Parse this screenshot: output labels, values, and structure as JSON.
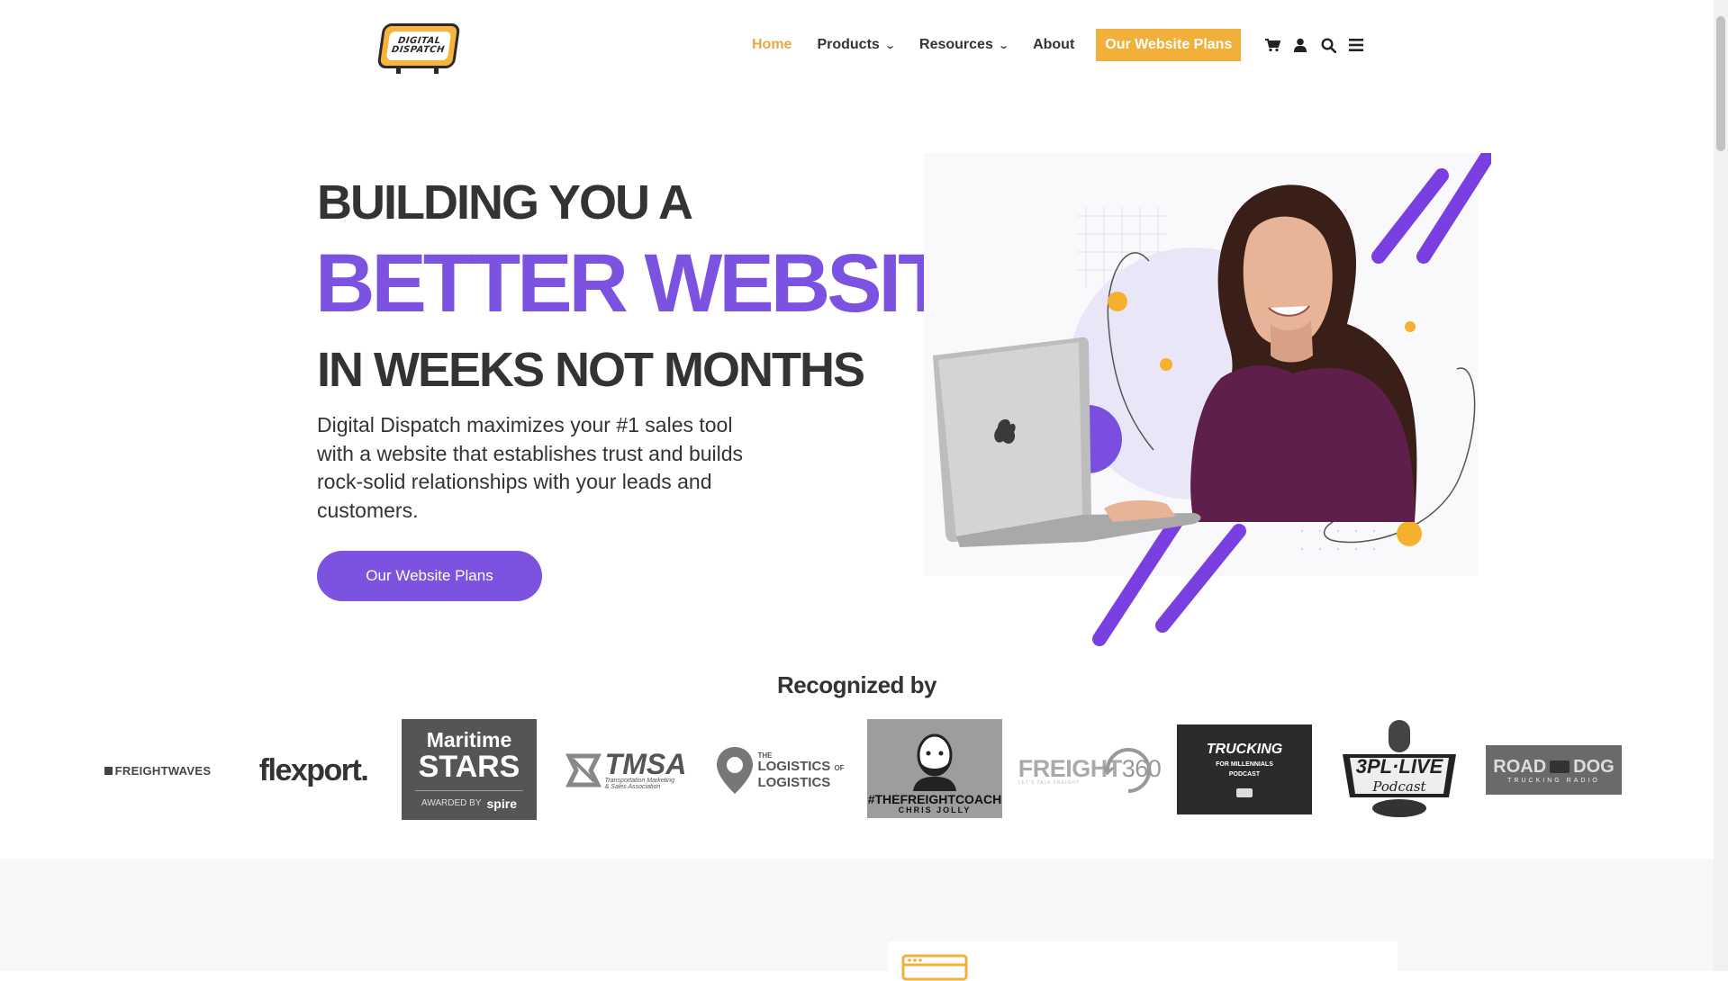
{
  "logo": {
    "line1": "DIGITAL",
    "line2": "DISPATCH"
  },
  "nav": {
    "items": [
      {
        "label": "Home",
        "active": true
      },
      {
        "label": "Products",
        "dropdown": true
      },
      {
        "label": "Resources",
        "dropdown": true
      },
      {
        "label": "About"
      }
    ],
    "cta_label": "Our Website Plans",
    "icons": [
      "cart-icon",
      "user-icon",
      "search-icon",
      "menu-icon"
    ]
  },
  "hero": {
    "line1": "BUILDING YOU A",
    "line2": "BETTER WEBSITE",
    "line3": "IN WEEKS NOT MONTHS",
    "description": "Digital Dispatch maximizes your #1 sales tool with a website that establishes trust and builds rock-solid relationships with your leads and customers.",
    "button_label": "Our Website Plans"
  },
  "recognized": {
    "title": "Recognized by",
    "logos": [
      {
        "text": "FREIGHTWAVES"
      },
      {
        "text": "flexport."
      },
      {
        "line1": "Maritime",
        "line2": "STARS",
        "sub": "AWARDED BY",
        "brand": "spire"
      },
      {
        "text": "TMSA",
        "sub1": "Transportation Marketing",
        "sub2": "& Sales Association"
      },
      {
        "small": "THE",
        "line1": "LOGISTICS",
        "of": "OF",
        "line2": "LOGISTICS"
      },
      {
        "line1": "#THEFREIGHTCOACH",
        "line2": "CHRIS JOLLY"
      },
      {
        "text": "FREIGHT",
        "num": "360",
        "sub": "LET'S TALK FREIGHT"
      },
      {
        "line1": "TRUCKING",
        "line2": "FOR MILLENNIALS",
        "line3": "PODCAST"
      },
      {
        "line1": "3PL·LIVE",
        "line2": "Podcast"
      },
      {
        "line1": "ROAD",
        "line2": "DOG",
        "sub": "TRUCKING RADIO"
      }
    ]
  },
  "colors": {
    "accent": "#7b53e0",
    "brand_orange": "#f2b03a",
    "nav_active": "#e9a645",
    "text": "#333333"
  }
}
